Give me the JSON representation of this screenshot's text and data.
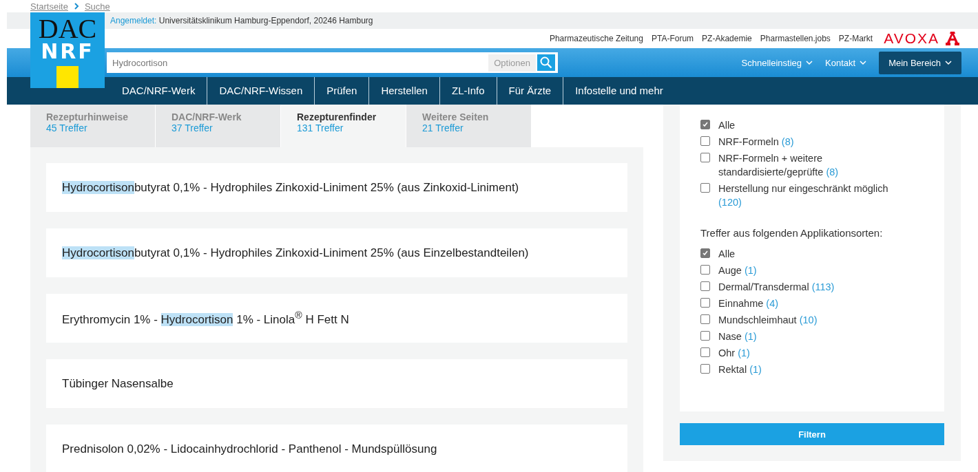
{
  "breadcrumb": [
    {
      "label": "Startseite"
    },
    {
      "label": "Suche"
    }
  ],
  "login": {
    "label": "Angemeldet:",
    "value": "Universitätsklinikum Hamburg-Eppendorf, 20246 Hamburg"
  },
  "logo": {
    "line_1": "DAC",
    "line_2": "NRF"
  },
  "partner_links": [
    "Pharmazeutische Zeitung",
    "PTA-Forum",
    "PZ-Akademie",
    "Pharmastellen.jobs",
    "PZ-Markt"
  ],
  "brand": "AVOXA",
  "search": {
    "value": "Hydrocortison",
    "options_label": "Optionen"
  },
  "header_menus": [
    {
      "label": "Schnelleinstieg",
      "kind": "link"
    },
    {
      "label": "Kontakt",
      "kind": "link"
    },
    {
      "label": "Mein Bereich",
      "kind": "button"
    }
  ],
  "nav": [
    "DAC/NRF-Werk",
    "DAC/NRF-Wissen",
    "Prüfen",
    "Herstellen",
    "ZL-Info",
    "Für Ärzte",
    "Infostelle und mehr"
  ],
  "tabs": [
    {
      "label": "Rezepturhinweise",
      "count": "45 Treffer",
      "selected": false
    },
    {
      "label": "DAC/NRF-Werk",
      "count": "37 Treffer",
      "selected": false
    },
    {
      "label": "Rezepturenfinder",
      "count": "131 Treffer",
      "selected": true
    },
    {
      "label": "Weitere Seiten",
      "count": "21 Treffer",
      "selected": false
    }
  ],
  "results": [
    {
      "parts": [
        {
          "text": "Hydrocortison",
          "highlight": true
        },
        {
          "text": "butyrat 0,1% - Hydrophiles Zinkoxid-Liniment 25% (aus Zinkoxid-Liniment)",
          "highlight": false
        }
      ]
    },
    {
      "parts": [
        {
          "text": "Hydrocortison",
          "highlight": true
        },
        {
          "text": "butyrat 0,1% - Hydrophiles Zinkoxid-Liniment 25% (aus Einzelbestandteilen)",
          "highlight": false
        }
      ]
    },
    {
      "parts": [
        {
          "text": "Erythromycin 1% - ",
          "highlight": false
        },
        {
          "text": "Hydrocortison",
          "highlight": true
        },
        {
          "text": " 1% - Linola$^{®}$ H Fett N",
          "highlight": false
        }
      ]
    },
    {
      "parts": [
        {
          "text": "Tübinger Nasensalbe",
          "highlight": false
        }
      ]
    },
    {
      "parts": [
        {
          "text": "Prednisolon 0,02% - Lidocainhydrochlorid - Panthenol - Mundspüllösung",
          "highlight": false
        }
      ]
    }
  ],
  "filters": {
    "group_1": [
      {
        "label": "Alle",
        "checked": true
      },
      {
        "label": "NRF-Formeln",
        "count": "(8)",
        "checked": false
      },
      {
        "label": "NRF-Formeln + weitere standardisierte/geprüfte",
        "count": "(8)",
        "checked": false
      },
      {
        "label": "Herstellung nur eingeschränkt möglich",
        "count": "(120)",
        "checked": false
      }
    ],
    "group_2_title": "Treffer aus folgenden Applikationsorten:",
    "group_2": [
      {
        "label": "Alle",
        "checked": true
      },
      {
        "label": "Auge",
        "count": "(1)",
        "checked": false
      },
      {
        "label": "Dermal/Transdermal",
        "count": "(113)",
        "checked": false
      },
      {
        "label": "Einnahme",
        "count": "(4)",
        "checked": false
      },
      {
        "label": "Mundschleimhaut",
        "count": "(10)",
        "checked": false
      },
      {
        "label": "Nase",
        "count": "(1)",
        "checked": false
      },
      {
        "label": "Ohr",
        "count": "(1)",
        "checked": false
      },
      {
        "label": "Rektal",
        "count": "(1)",
        "checked": false
      }
    ],
    "button": "Filtern"
  }
}
